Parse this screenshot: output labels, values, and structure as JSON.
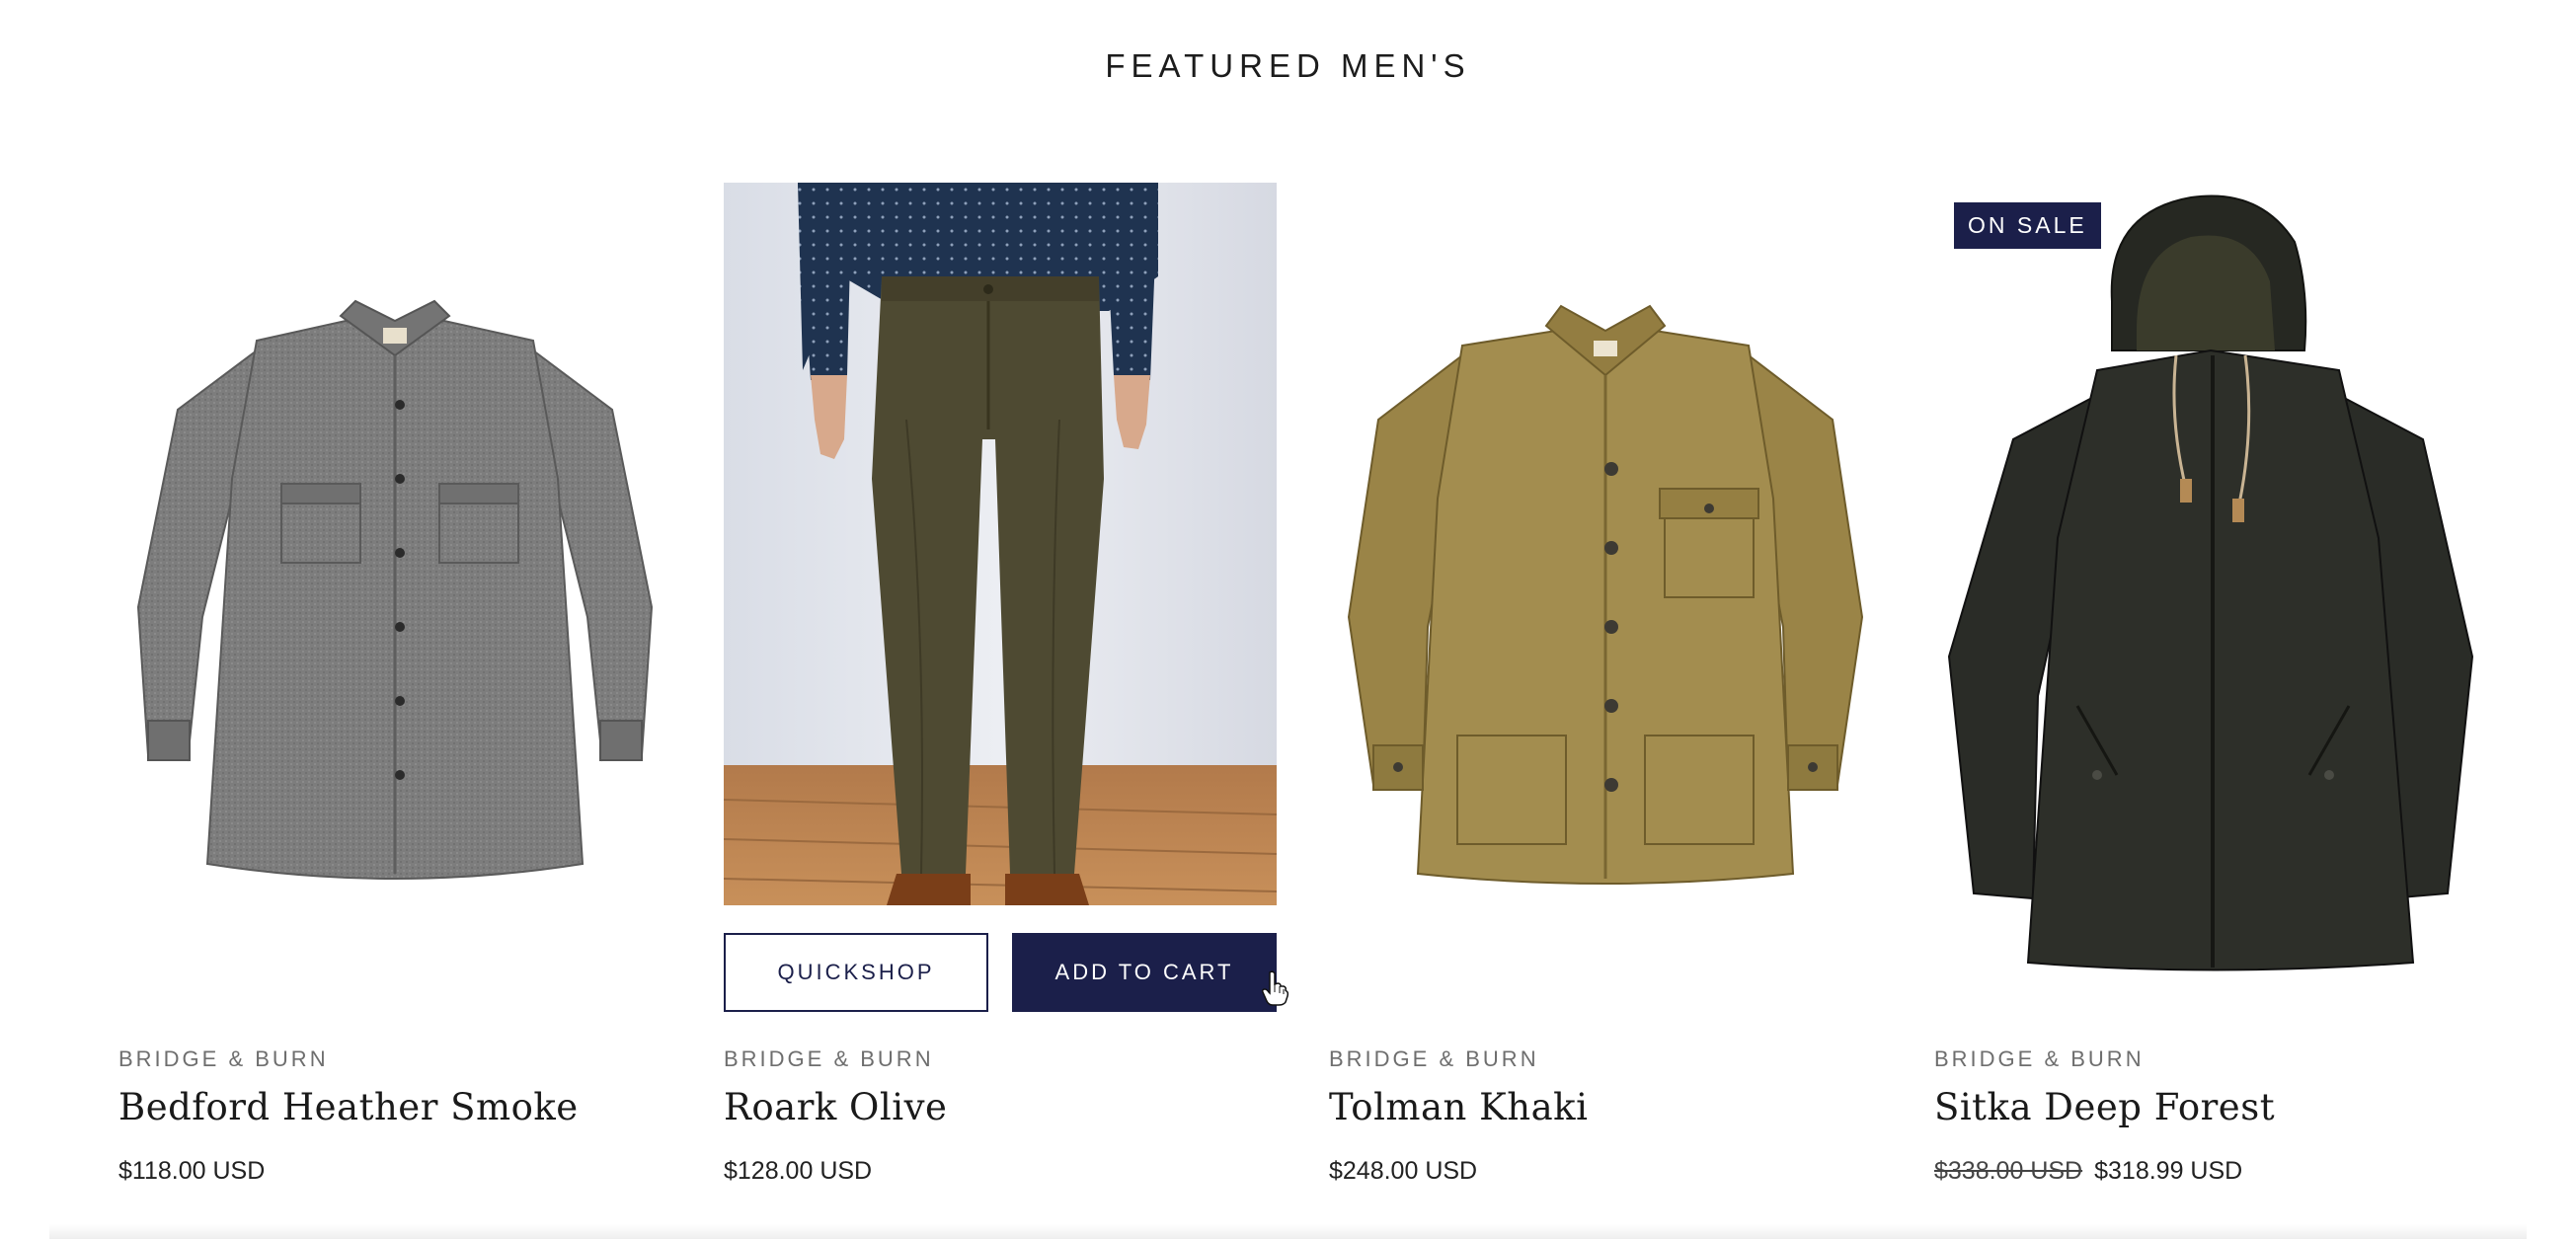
{
  "section": {
    "title": "FEATURED MEN'S"
  },
  "colors": {
    "accent": "#1b1f4a"
  },
  "products": [
    {
      "brand": "BRIDGE & BURN",
      "name": "Bedford Heather Smoke",
      "price": "$118.00 USD",
      "image": "gray-flannel-shirt"
    },
    {
      "brand": "BRIDGE & BURN",
      "name": "Roark Olive",
      "price": "$128.00 USD",
      "image": "olive-chino-pants-on-model"
    },
    {
      "brand": "BRIDGE & BURN",
      "name": "Tolman Khaki",
      "price": "$248.00 USD",
      "image": "khaki-chore-jacket"
    },
    {
      "brand": "BRIDGE & BURN",
      "name": "Sitka Deep Forest",
      "compare_price": "$338.00 USD",
      "price": "$318.99 USD",
      "badge": "ON SALE",
      "image": "dark-hooded-parka"
    }
  ],
  "hover_actions": {
    "quickshop": "QUICKSHOP",
    "add_to_cart": "ADD TO CART"
  },
  "cursor": "hand-pointer-icon"
}
